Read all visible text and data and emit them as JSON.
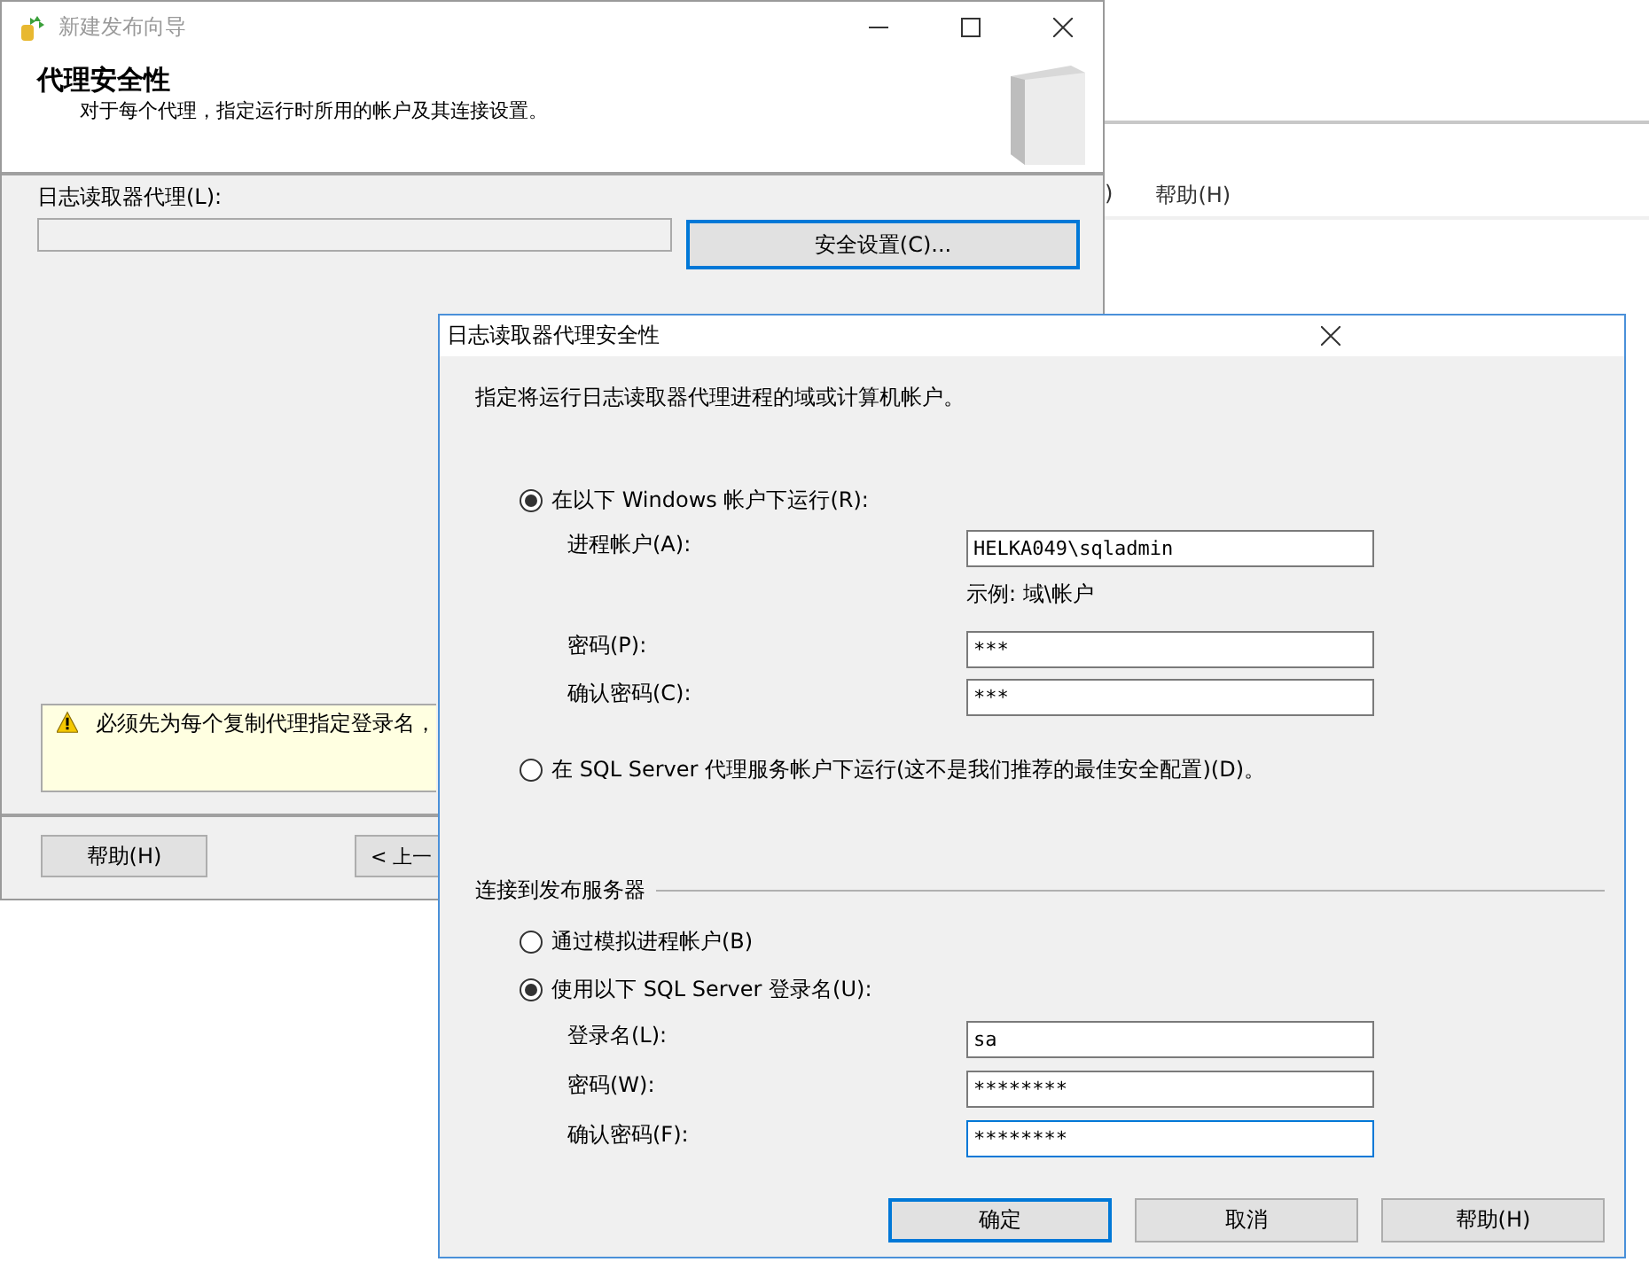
{
  "background_window": {
    "menu_items": [
      ")",
      "帮助(H)"
    ]
  },
  "wizard": {
    "title": "新建发布向导",
    "header": {
      "title": "代理安全性",
      "subtitle": "对于每个代理，指定运行时所用的帐户及其连接设置。"
    },
    "agent_label": "日志读取器代理(L):",
    "agent_field": {
      "disabled": true
    },
    "security_button": "安全设置(C)...",
    "warning": "必须先为每个复制代理指定登录名，",
    "buttons": [
      "帮助(H)",
      "< 上一"
    ]
  },
  "dialog": {
    "title": "日志读取器代理安全性",
    "instruction": "指定将运行日志读取器代理进程的域或计算机帐户。",
    "windows_account": {
      "label": "在以下 Windows 帐户下运行(R):",
      "selected": true
    },
    "process_account": {
      "label": "进程帐户(A):",
      "value": "HELKA049\\sqladmin",
      "focused": false
    },
    "example": "示例: 域\\帐户",
    "password": {
      "label": "密码(P):",
      "value": "***",
      "focused": false
    },
    "confirm_password": {
      "label": "确认密码(C):",
      "value": "***",
      "focused": false
    },
    "agent_service_account": {
      "label": "在 SQL Server 代理服务帐户下运行(这不是我们推荐的最佳安全配置)(D)。",
      "selected": false
    },
    "connect_group": "连接到发布服务器",
    "impersonate": {
      "label": "通过模拟进程帐户(B)",
      "selected": false
    },
    "sql_login": {
      "label": "使用以下 SQL Server 登录名(U):",
      "selected": true
    },
    "login_fields": [
      {
        "label": "登录名(L):",
        "value": "sa",
        "focused": false
      },
      {
        "label": "密码(W):",
        "value": "********",
        "focused": false
      },
      {
        "label": "确认密码(F):",
        "value": "********",
        "focused": true
      }
    ],
    "buttons": [
      {
        "label": "确定",
        "default": true
      },
      {
        "label": "取消",
        "default": false
      },
      {
        "label": "帮助(H)",
        "default": false
      }
    ]
  }
}
